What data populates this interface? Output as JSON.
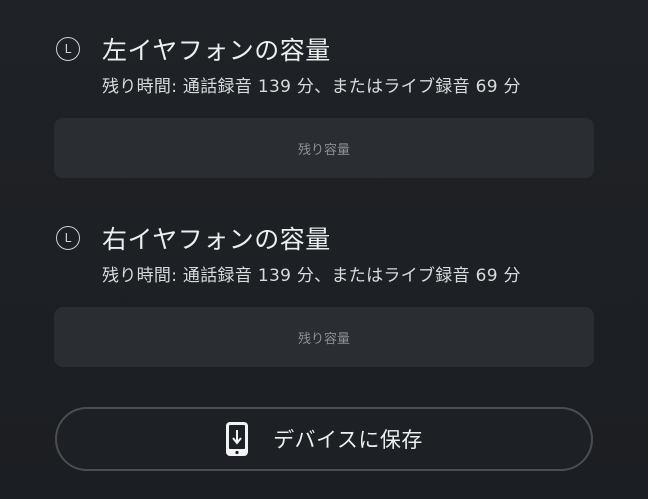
{
  "left_earbud": {
    "icon_letter": "L",
    "title": "左イヤフォンの容量",
    "subtitle": "残り時間: 通話録音 139 分、またはライブ録音 69 分",
    "capacity_label": "残り容量"
  },
  "right_earbud": {
    "icon_letter": "L",
    "title": "右イヤフォンの容量",
    "subtitle": "残り時間: 通話録音 139 分、またはライブ録音 69 分",
    "capacity_label": "残り容量"
  },
  "save_button": {
    "label": "デバイスに保存",
    "icon": "phone-download-icon"
  }
}
